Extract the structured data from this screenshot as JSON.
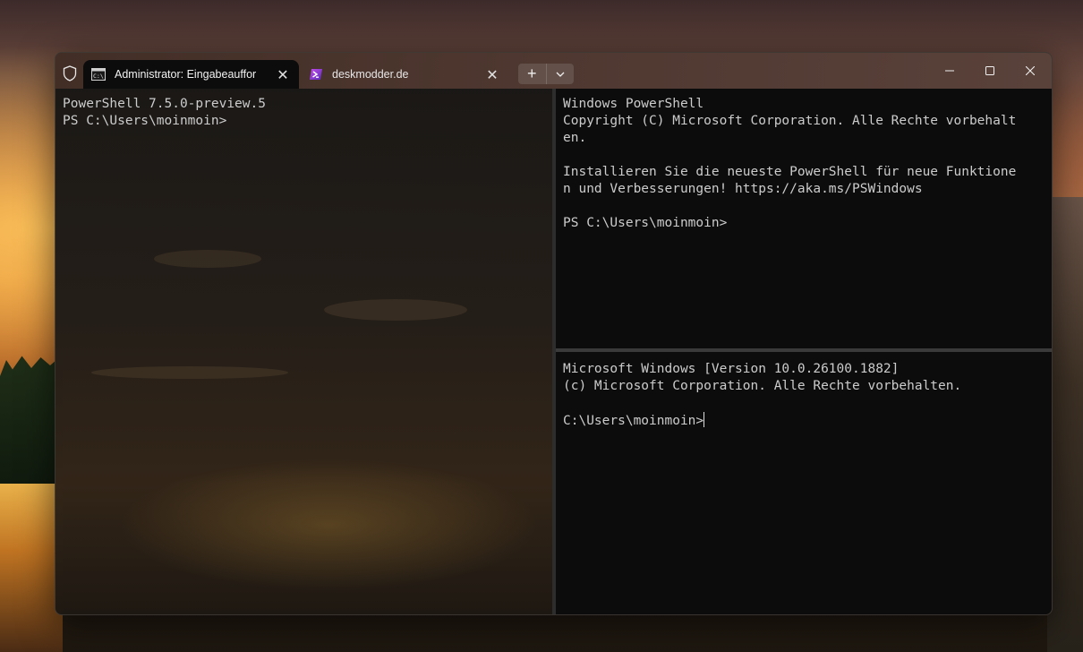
{
  "tabs": [
    {
      "title": "Administrator: Eingabeauffor",
      "close": "✕"
    },
    {
      "title": "deskmodder.de",
      "close": "✕"
    }
  ],
  "newtab": {
    "plus": "+"
  },
  "panes": {
    "left": {
      "lines": [
        "PowerShell 7.5.0-preview.5",
        "PS C:\\Users\\moinmoin>"
      ]
    },
    "top_right": {
      "lines": [
        "Windows PowerShell",
        "Copyright (C) Microsoft Corporation. Alle Rechte vorbehalt",
        "en.",
        "",
        "Installieren Sie die neueste PowerShell für neue Funktione",
        "n und Verbesserungen! https://aka.ms/PSWindows",
        "",
        "PS C:\\Users\\moinmoin>"
      ]
    },
    "bottom_right": {
      "lines": [
        "Microsoft Windows [Version 10.0.26100.1882]",
        "(c) Microsoft Corporation. Alle Rechte vorbehalten.",
        "",
        "C:\\Users\\moinmoin>"
      ]
    }
  },
  "icons": {
    "shield": "shield-icon",
    "cmd": "cmd-icon",
    "powershell": "powershell-icon",
    "chevron": "chevron-down-icon",
    "minimize": "minimize-icon",
    "maximize": "maximize-icon",
    "close": "close-icon"
  },
  "colors": {
    "terminal_bg": "#0c0c0c",
    "terminal_fg": "#cccccc",
    "titlebar": "#4f3a33"
  }
}
